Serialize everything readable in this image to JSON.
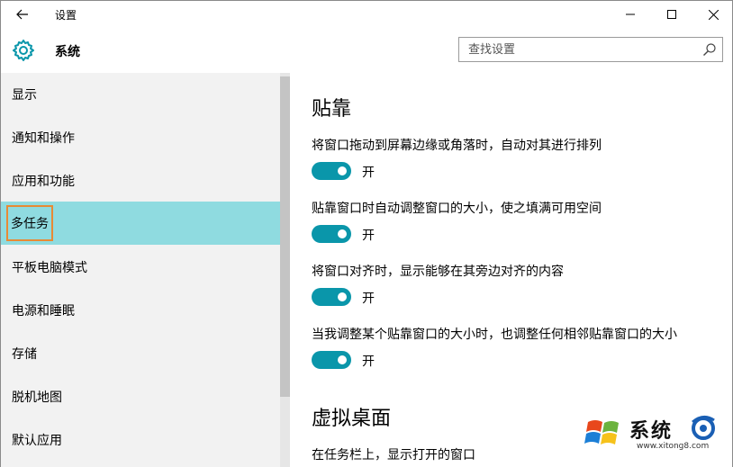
{
  "titlebar": {
    "back_icon": "arrow-left-icon",
    "title": "设置",
    "minimize_icon": "minimize-icon",
    "maximize_icon": "maximize-icon",
    "close_icon": "close-icon"
  },
  "header": {
    "icon": "gear-icon",
    "title": "系统",
    "search_placeholder": "查找设置",
    "search_icon": "search-icon"
  },
  "sidebar": {
    "items": [
      {
        "label": "显示",
        "active": false
      },
      {
        "label": "通知和操作",
        "active": false
      },
      {
        "label": "应用和功能",
        "active": false
      },
      {
        "label": "多任务",
        "active": true
      },
      {
        "label": "平板电脑模式",
        "active": false
      },
      {
        "label": "电源和睡眠",
        "active": false
      },
      {
        "label": "存储",
        "active": false
      },
      {
        "label": "脱机地图",
        "active": false
      },
      {
        "label": "默认应用",
        "active": false
      }
    ]
  },
  "main": {
    "snap": {
      "title": "贴靠",
      "settings": [
        {
          "description": "将窗口拖动到屏幕边缘或角落时，自动对其进行排列",
          "state": "开",
          "on": true
        },
        {
          "description": "贴靠窗口时自动调整窗口的大小，使之填满可用空间",
          "state": "开",
          "on": true
        },
        {
          "description": "将窗口对齐时，显示能够在其旁边对齐的内容",
          "state": "开",
          "on": true
        },
        {
          "description": "当我调整某个贴靠窗口的大小时，也调整任何相邻贴靠窗口的大小",
          "state": "开",
          "on": true
        }
      ]
    },
    "virtual_desktops": {
      "title": "虚拟桌面",
      "first_setting": "在任务栏上，显示打开的窗口"
    }
  },
  "colors": {
    "accent": "#0a96aa",
    "selected_bg": "#8fdbe0",
    "highlight_border": "#e88a35"
  },
  "watermark": {
    "text": "系统",
    "url": "www.xitong8.com"
  }
}
